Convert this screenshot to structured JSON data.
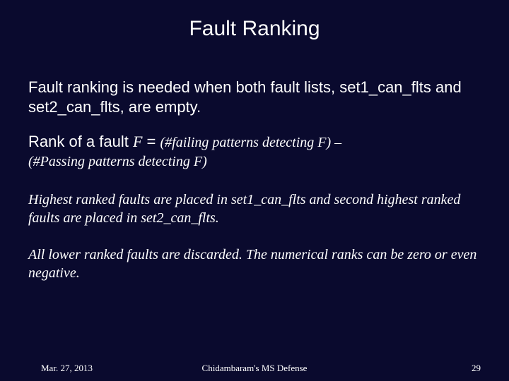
{
  "title": "Fault Ranking",
  "para1": "Fault ranking is needed when both fault lists, set1_can_flts and set2_can_flts, are empty.",
  "rank_lead": "Rank of a fault ",
  "rank_f": "F",
  "rank_eq": " = ",
  "rank_tail": "(#failing patterns detecting F) – ",
  "rank_line2": "(#Passing patterns detecting F)",
  "para3": "Highest ranked faults are placed in set1_can_flts and second highest ranked faults are placed in set2_can_flts.",
  "para4": "All lower ranked faults are discarded. The numerical ranks can be zero or even negative.",
  "footer": {
    "date": "Mar. 27, 2013",
    "center": "Chidambaram's MS Defense",
    "page": "29"
  }
}
